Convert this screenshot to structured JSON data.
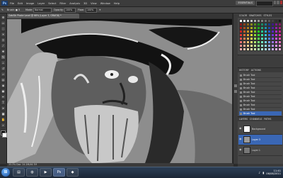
{
  "app": {
    "logo": "Ps",
    "menus": [
      "File",
      "Edit",
      "Image",
      "Layer",
      "Select",
      "Filter",
      "Analysis",
      "3D",
      "View",
      "Window",
      "Help"
    ],
    "workspace": "ESSENTIALS"
  },
  "options_bar": {
    "brush_label": "Brush:",
    "brush_size": "5",
    "mode_label": "Mode:",
    "mode_value": "Normal",
    "opacity_label": "Opacity:",
    "opacity_value": "100%",
    "flow_label": "Flow:",
    "flow_value": "100%"
  },
  "document": {
    "tab_title": "GebSik Pirate Level @ 66% (Layer 3, GRAY/8) *",
    "status_text": "33.3%   Doc: 24.2M/46.7M"
  },
  "panels": {
    "swatches_tabs": [
      "COLOR",
      "SWATCHES",
      "STYLES"
    ],
    "history_tabs": [
      "HISTORY",
      "ACTIONS"
    ],
    "history_items": [
      "Brush Tool",
      "Brush Tool",
      "Brush Tool",
      "Brush Tool",
      "Brush Tool",
      "Brush Tool",
      "Brush Tool",
      "Brush Tool",
      "Brush Tool",
      "Brush Tool"
    ],
    "layers_tabs": [
      "LAYERS",
      "CHANNELS",
      "PATHS"
    ],
    "layers": [
      {
        "name": "Background"
      },
      {
        "name": "Layer 3"
      },
      {
        "name": "Layer 1"
      }
    ]
  },
  "taskbar": {
    "time": "11:41",
    "date": "06/08/2011"
  },
  "colors": {
    "selection": "#3a67b5",
    "canvas_gray": "#8c8c8c"
  },
  "icons": [
    "photoshop-logo-icon",
    "move-tool-icon",
    "marquee-tool-icon",
    "lasso-tool-icon",
    "wand-tool-icon",
    "crop-tool-icon",
    "eyedropper-icon",
    "healing-icon",
    "brush-tool-icon",
    "clone-stamp-icon",
    "history-brush-icon",
    "eraser-icon",
    "gradient-icon",
    "blur-icon",
    "dodge-icon",
    "pen-icon",
    "type-icon",
    "path-select-icon",
    "shape-icon",
    "hand-icon",
    "zoom-icon",
    "windows-start-icon",
    "eye-icon"
  ]
}
